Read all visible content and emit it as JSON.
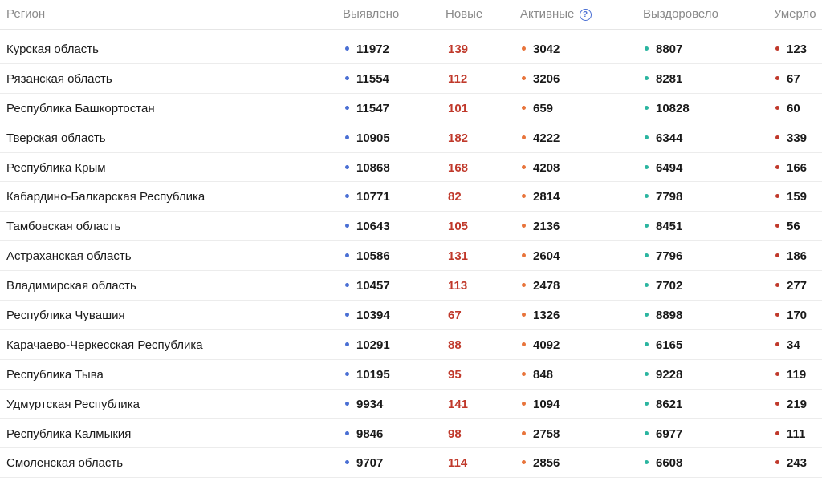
{
  "header": {
    "region": "Регион",
    "detected": "Выявлено",
    "new": "Новые",
    "active": "Активные",
    "active_help": "?",
    "recovered": "Выздоровело",
    "died": "Умерло"
  },
  "colors": {
    "detected_dot": "#4a6fd4",
    "new_text": "#c0392b",
    "active_dot": "#e8743b",
    "recovered_dot": "#2bb5a0",
    "died_dot": "#c0392b",
    "help_icon": "#4a6fd4"
  },
  "rows": [
    {
      "region": "Курская область",
      "detected": "11972",
      "new": "139",
      "active": "3042",
      "recovered": "8807",
      "died": "123"
    },
    {
      "region": "Рязанская область",
      "detected": "11554",
      "new": "112",
      "active": "3206",
      "recovered": "8281",
      "died": "67"
    },
    {
      "region": "Республика Башкортостан",
      "detected": "11547",
      "new": "101",
      "active": "659",
      "recovered": "10828",
      "died": "60"
    },
    {
      "region": "Тверская область",
      "detected": "10905",
      "new": "182",
      "active": "4222",
      "recovered": "6344",
      "died": "339"
    },
    {
      "region": "Республика Крым",
      "detected": "10868",
      "new": "168",
      "active": "4208",
      "recovered": "6494",
      "died": "166"
    },
    {
      "region": "Кабардино-Балкарская Республика",
      "detected": "10771",
      "new": "82",
      "active": "2814",
      "recovered": "7798",
      "died": "159"
    },
    {
      "region": "Тамбовская область",
      "detected": "10643",
      "new": "105",
      "active": "2136",
      "recovered": "8451",
      "died": "56"
    },
    {
      "region": "Астраханская область",
      "detected": "10586",
      "new": "131",
      "active": "2604",
      "recovered": "7796",
      "died": "186"
    },
    {
      "region": "Владимирская область",
      "detected": "10457",
      "new": "113",
      "active": "2478",
      "recovered": "7702",
      "died": "277"
    },
    {
      "region": "Республика Чувашия",
      "detected": "10394",
      "new": "67",
      "active": "1326",
      "recovered": "8898",
      "died": "170"
    },
    {
      "region": "Карачаево-Черкесская Республика",
      "detected": "10291",
      "new": "88",
      "active": "4092",
      "recovered": "6165",
      "died": "34"
    },
    {
      "region": "Республика Тыва",
      "detected": "10195",
      "new": "95",
      "active": "848",
      "recovered": "9228",
      "died": "119"
    },
    {
      "region": "Удмуртская Республика",
      "detected": "9934",
      "new": "141",
      "active": "1094",
      "recovered": "8621",
      "died": "219"
    },
    {
      "region": "Республика Калмыкия",
      "detected": "9846",
      "new": "98",
      "active": "2758",
      "recovered": "6977",
      "died": "111"
    },
    {
      "region": "Смоленская область",
      "detected": "9707",
      "new": "114",
      "active": "2856",
      "recovered": "6608",
      "died": "243"
    }
  ]
}
